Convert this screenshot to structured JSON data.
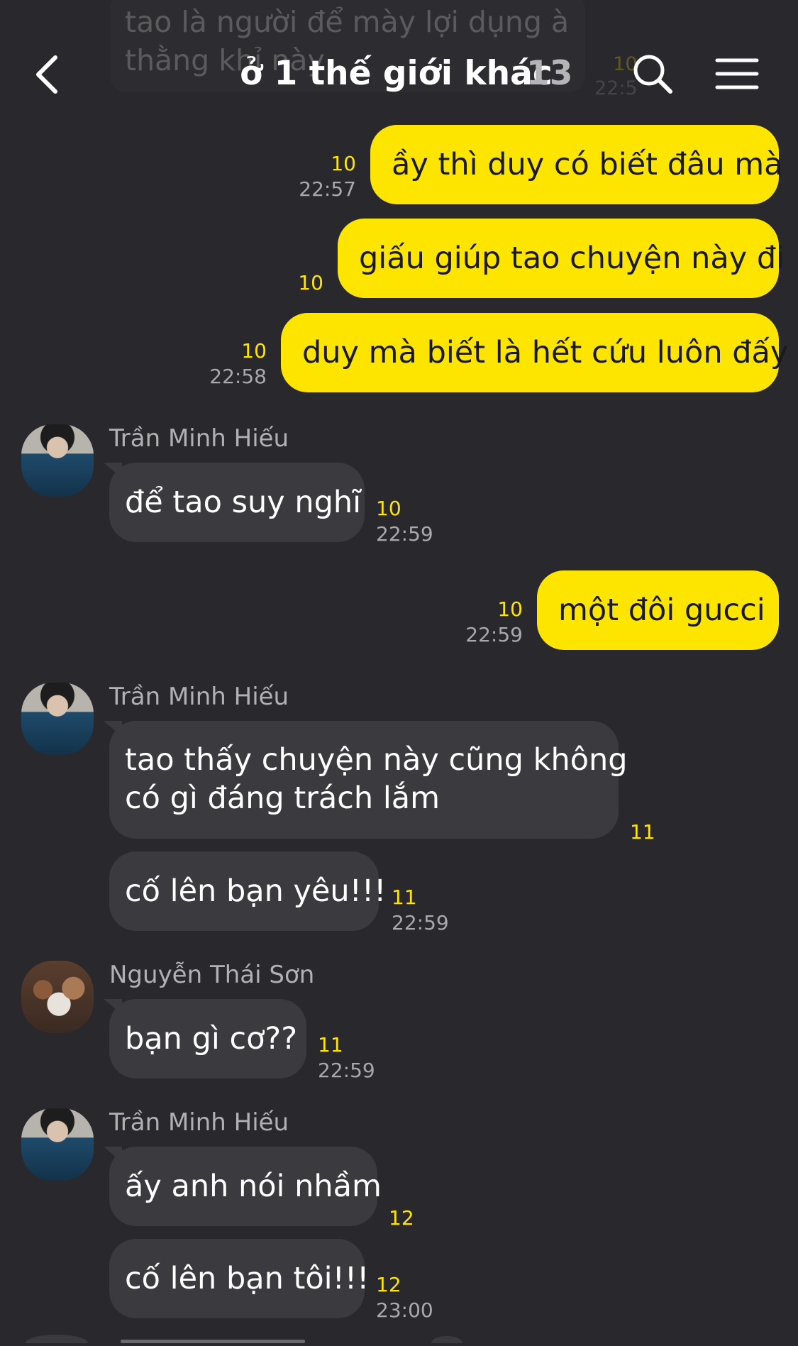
{
  "header": {
    "title": "ở 1 thế giới khác",
    "member_count": "13"
  },
  "faded_message": {
    "line1": "tao là người để mày lợi dụng à",
    "line2": "thằng khỉ này",
    "count": "10",
    "time": "22:5"
  },
  "messages": [
    {
      "text": "ầy thì duy có biết đâu mà",
      "count": "10",
      "time": "22:57"
    },
    {
      "text": "giấu giúp tao chuyện này đi",
      "count": "10",
      "time": ""
    },
    {
      "text": "duy mà biết là hết cứu luôn đấy",
      "count": "10",
      "time": "22:58"
    },
    {
      "sender": "Trần Minh Hiếu",
      "text": "để tao suy nghĩ",
      "count": "10",
      "time": "22:59"
    },
    {
      "text": "một đôi gucci",
      "count": "10",
      "time": "22:59"
    },
    {
      "sender": "Trần Minh Hiếu",
      "line1": "tao thấy chuyện này cũng không",
      "line2": "có gì đáng trách lắm",
      "count": "11",
      "time": ""
    },
    {
      "text": "cố lên bạn yêu!!!",
      "count": "11",
      "time": "22:59"
    },
    {
      "sender": "Nguyễn Thái Sơn",
      "text": "bạn gì cơ??",
      "count": "11",
      "time": "22:59"
    },
    {
      "sender": "Trần Minh Hiếu",
      "text": "ấy anh nói nhầm",
      "count": "12",
      "time": ""
    },
    {
      "text": "cố lên bạn tôi!!!",
      "count": "12",
      "time": "23:00"
    }
  ],
  "colors": {
    "background": "#29292d",
    "outgoing_bubble": "#fee500",
    "incoming_bubble": "#3b3b3f",
    "unread_count": "#ffe500"
  }
}
